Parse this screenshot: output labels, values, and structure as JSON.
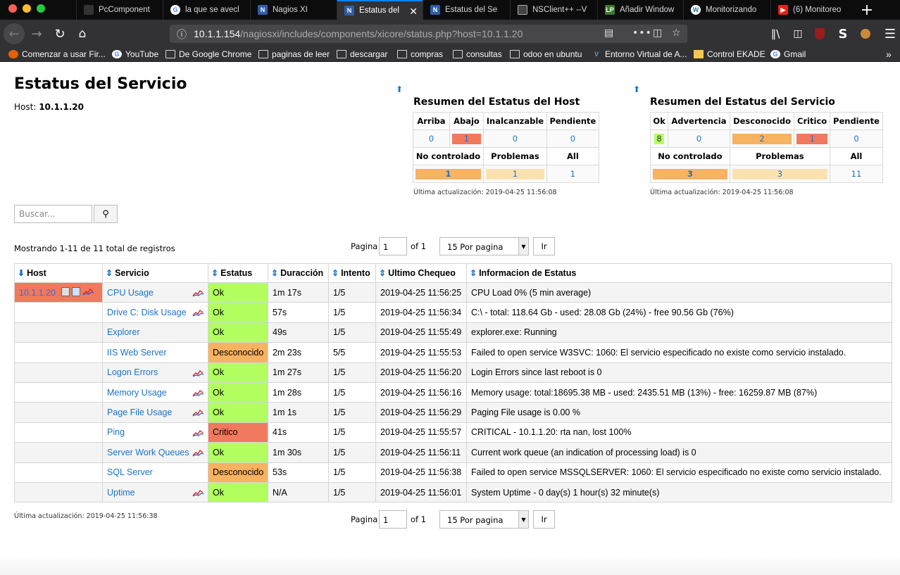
{
  "browser": {
    "tabs": [
      {
        "title": "PcComponent",
        "icon": "pccomponentes-icon"
      },
      {
        "title": "la que se avecl",
        "icon": "google-icon"
      },
      {
        "title": "Nagios XI",
        "icon": "nagios-icon"
      },
      {
        "title": "Estatus del",
        "icon": "nagios-icon",
        "active": true
      },
      {
        "title": "Estatus del Se",
        "icon": "nagios-icon"
      },
      {
        "title": "NSClient++ --V",
        "icon": "nsclient-icon"
      },
      {
        "title": "Añadir Window",
        "icon": "lp-icon"
      },
      {
        "title": "Monitorizando",
        "icon": "wordpress-icon"
      },
      {
        "title": "(6) Monitoreo",
        "icon": "youtube-icon"
      }
    ],
    "url_host": "10.1.1.154",
    "url_path": "/nagiosxi/includes/components/xicore/status.php?host=10.1.1.20",
    "bookmarks": [
      {
        "label": "Comenzar a usar Fir...",
        "icon": "firefox-icon"
      },
      {
        "label": "YouTube",
        "icon": "google-icon"
      },
      {
        "label": "De Google Chrome",
        "icon": "folder-icon"
      },
      {
        "label": "paginas de leer",
        "icon": "folder-icon"
      },
      {
        "label": "descargar",
        "icon": "folder-icon"
      },
      {
        "label": "compras",
        "icon": "folder-icon"
      },
      {
        "label": "consultas",
        "icon": "folder-icon"
      },
      {
        "label": "odoo en ubuntu",
        "icon": "folder-icon"
      },
      {
        "label": "Entorno Virtual de A...",
        "icon": "entorno-icon"
      },
      {
        "label": "Control EKADE",
        "icon": "ekade-icon"
      },
      {
        "label": "Gmail",
        "icon": "google-icon"
      }
    ]
  },
  "page": {
    "title": "Estatus del Servicio",
    "host_label": "Host:",
    "host_value": "10.1.1.20"
  },
  "host_summary": {
    "title": "Resumen del Estatus del Host",
    "headers": [
      "Arriba",
      "Abajo",
      "Inalcanzable",
      "Pendiente"
    ],
    "values": [
      "0",
      "1",
      "0",
      "0"
    ],
    "headers2": [
      "No controlado",
      "Problemas",
      "All"
    ],
    "values2": [
      "1",
      "1",
      "1"
    ],
    "updated": "Última actualización: 2019-04-25 11:56:08"
  },
  "service_summary": {
    "title": "Resumen del Estatus del Servicio",
    "headers": [
      "Ok",
      "Advertencia",
      "Desconocido",
      "Critico",
      "Pendiente"
    ],
    "values": [
      "8",
      "0",
      "2",
      "1",
      "0"
    ],
    "headers2": [
      "No controlado",
      "Problemas",
      "All"
    ],
    "values2": [
      "3",
      "3",
      "11"
    ],
    "updated": "Última actualización: 2019-04-25 11:56:08"
  },
  "search": {
    "placeholder": "Buscar..."
  },
  "showing": "Mostrando 1-11 de 11 total de registros",
  "pager": {
    "label": "Pagina",
    "page": "1",
    "of": "of 1",
    "per_page": "15 Por pagina",
    "go": "Ir"
  },
  "table": {
    "columns": [
      "Host",
      "Servicio",
      "Estatus",
      "Duracción",
      "Intento",
      "Ultimo Chequeo",
      "Informacion de Estatus"
    ],
    "host": "10.1.1.20",
    "rows": [
      {
        "service": "CPU Usage",
        "graph": true,
        "status": "Ok",
        "duration": "1m 17s",
        "attempt": "1/5",
        "last_check": "2019-04-25 11:56:25",
        "info": "CPU Load 0% (5 min average)"
      },
      {
        "service": "Drive C: Disk Usage",
        "graph": true,
        "status": "Ok",
        "duration": "57s",
        "attempt": "1/5",
        "last_check": "2019-04-25 11:56:34",
        "info": "C:\\ - total: 118.64 Gb - used: 28.08 Gb (24%) - free 90.56 Gb (76%)"
      },
      {
        "service": "Explorer",
        "graph": false,
        "status": "Ok",
        "duration": "49s",
        "attempt": "1/5",
        "last_check": "2019-04-25 11:55:49",
        "info": "explorer.exe: Running"
      },
      {
        "service": "IIS Web Server",
        "graph": false,
        "status": "Desconocido",
        "duration": "2m 23s",
        "attempt": "5/5",
        "last_check": "2019-04-25 11:55:53",
        "info": "Failed to open service W3SVC: 1060: El servicio especificado no existe como servicio instalado."
      },
      {
        "service": "Logon Errors",
        "graph": true,
        "status": "Ok",
        "duration": "1m 27s",
        "attempt": "1/5",
        "last_check": "2019-04-25 11:56:20",
        "info": "Login Errors since last reboot is 0"
      },
      {
        "service": "Memory Usage",
        "graph": true,
        "status": "Ok",
        "duration": "1m 28s",
        "attempt": "1/5",
        "last_check": "2019-04-25 11:56:16",
        "info": "Memory usage: total:18695.38 MB - used: 2435.51 MB (13%) - free: 16259.87 MB (87%)"
      },
      {
        "service": "Page File Usage",
        "graph": true,
        "status": "Ok",
        "duration": "1m 1s",
        "attempt": "1/5",
        "last_check": "2019-04-25 11:56:29",
        "info": "Paging File usage is 0.00 %"
      },
      {
        "service": "Ping",
        "graph": true,
        "status": "Critico",
        "duration": "41s",
        "attempt": "1/5",
        "last_check": "2019-04-25 11:55:57",
        "info": "CRITICAL - 10.1.1.20: rta nan, lost 100%"
      },
      {
        "service": "Server Work Queues",
        "graph": true,
        "status": "Ok",
        "duration": "1m 30s",
        "attempt": "1/5",
        "last_check": "2019-04-25 11:56:11",
        "info": "Current work queue (an indication of processing load) is 0"
      },
      {
        "service": "SQL Server",
        "graph": false,
        "status": "Desconocido",
        "duration": "53s",
        "attempt": "1/5",
        "last_check": "2019-04-25 11:56:38",
        "info": "Failed to open service MSSQLSERVER: 1060: El servicio especificado no existe como servicio instalado."
      },
      {
        "service": "Uptime",
        "graph": true,
        "status": "Ok",
        "duration": "N/A",
        "attempt": "1/5",
        "last_check": "2019-04-25 11:56:01",
        "info": "System Uptime - 0 day(s) 1 hour(s) 32 minute(s)"
      }
    ]
  },
  "footer_updated": "Última actualización: 2019-04-25 11:56:38",
  "colors": {
    "ok": "#b2ff5f",
    "unknown": "#f7b262",
    "critical": "#f0795e",
    "link": "#1a73c9"
  }
}
